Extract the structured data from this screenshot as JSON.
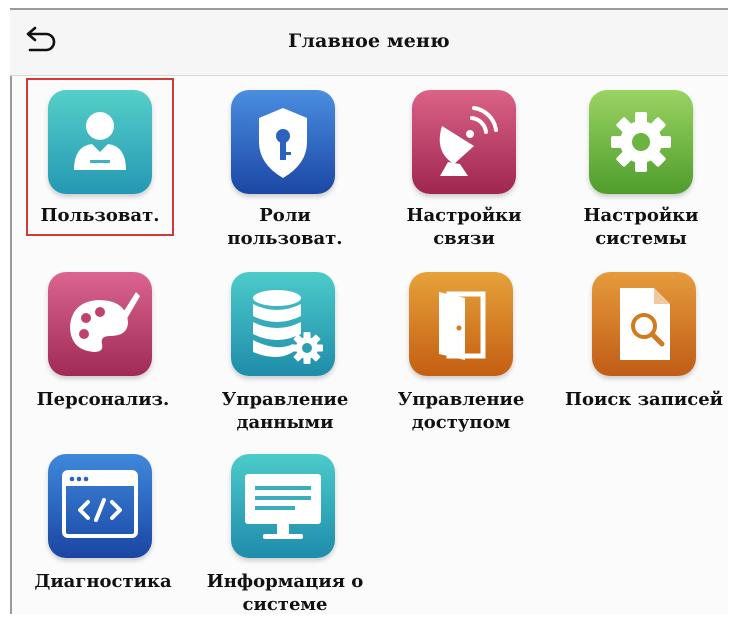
{
  "header": {
    "title": "Главное меню",
    "back_icon": "return-arrow-icon"
  },
  "menu": {
    "items": [
      {
        "label": "Пользоват.",
        "icon": "user-icon",
        "colors": [
          "#47c4c0",
          "#2aa2b5"
        ]
      },
      {
        "label": "Роли пользоват.",
        "icon": "shield-key-icon",
        "colors": [
          "#3b7fd8",
          "#1f4fad"
        ]
      },
      {
        "label": "Настройки связи",
        "icon": "satellite-dish-icon",
        "colors": [
          "#d4567a",
          "#a62a55"
        ]
      },
      {
        "label": "Настройки\nсистемы",
        "icon": "gear-icon",
        "colors": [
          "#8ccb57",
          "#5aa534"
        ]
      },
      {
        "label": "Персонализ.",
        "icon": "palette-icon",
        "colors": [
          "#d45a86",
          "#a8305b"
        ]
      },
      {
        "label": "Управление\nданными",
        "icon": "database-gear-icon",
        "colors": [
          "#3ec0c4",
          "#2392ad"
        ]
      },
      {
        "label": "Управление\nдоступом",
        "icon": "door-icon",
        "colors": [
          "#e0972e",
          "#c96b15"
        ]
      },
      {
        "label": "Поиск записей",
        "icon": "document-search-icon",
        "colors": [
          "#df8e33",
          "#c4661a"
        ]
      },
      {
        "label": "Диагностика",
        "icon": "code-window-icon",
        "colors": [
          "#3a7fd6",
          "#1f4ea8"
        ]
      },
      {
        "label": "Информация о\nсистеме",
        "icon": "monitor-icon",
        "colors": [
          "#3cc0c4",
          "#2394ad"
        ]
      }
    ],
    "selected_index": 0
  }
}
